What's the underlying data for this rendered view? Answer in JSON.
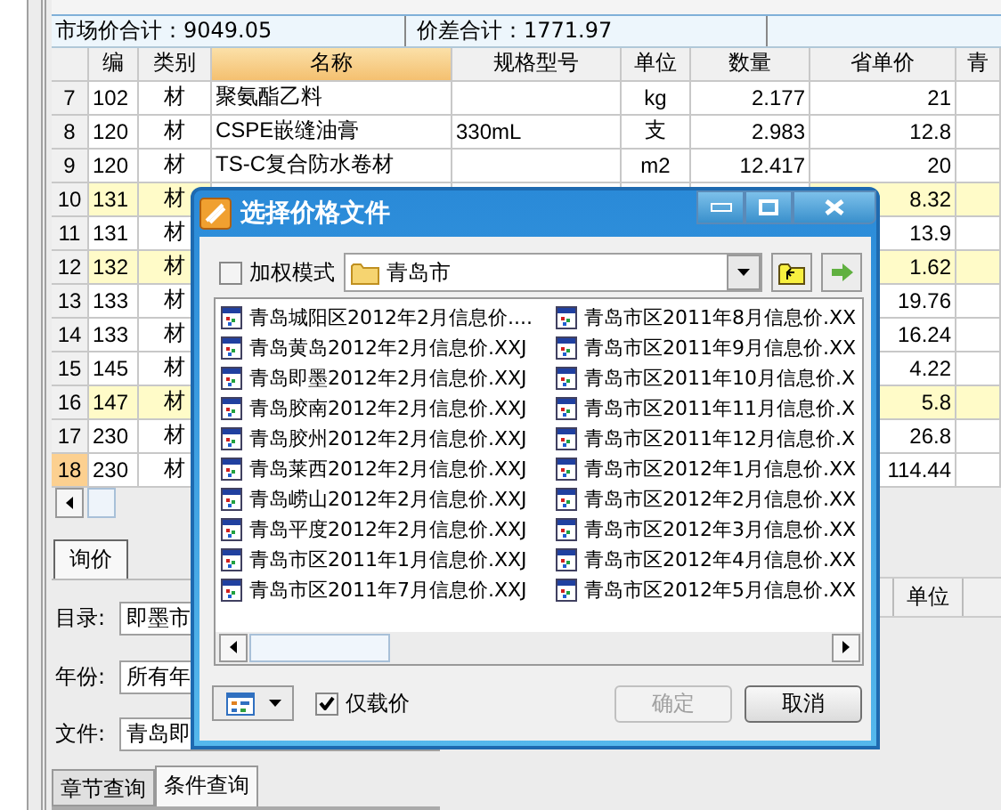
{
  "summary": {
    "market_total": "市场价合计：9049.05",
    "diff_total": "价差合计：1771.97"
  },
  "table": {
    "columns": [
      "编",
      "类别",
      "名称",
      "规格型号",
      "单位",
      "数量",
      "省单价",
      "青"
    ],
    "rows": [
      {
        "number": "7",
        "code": "102",
        "category": "材",
        "name": "聚氨酯乙料",
        "unit": "kg",
        "quantity": "2.177",
        "price": "21",
        "highlighted": false,
        "selected": false
      },
      {
        "number": "8",
        "code": "120",
        "category": "材",
        "name": "CSPE嵌缝油膏",
        "spec": "330mL",
        "unit": "支",
        "quantity": "2.983",
        "price": "12.8",
        "highlighted": false,
        "selected": false
      },
      {
        "number": "9",
        "code": "120",
        "category": "材",
        "name": "TS-C复合防水卷材",
        "unit": "m2",
        "quantity": "12.417",
        "price": "20",
        "highlighted": false,
        "selected": false
      },
      {
        "number": "10",
        "code": "131",
        "category": "材",
        "price": "8.32",
        "highlighted": true,
        "selected": false
      },
      {
        "number": "11",
        "code": "131",
        "category": "材",
        "price": "13.9",
        "highlighted": false,
        "selected": false
      },
      {
        "number": "12",
        "code": "132",
        "category": "材",
        "price": "1.62",
        "highlighted": true,
        "selected": false
      },
      {
        "number": "13",
        "code": "133",
        "category": "材",
        "price": "19.76",
        "highlighted": false,
        "selected": false
      },
      {
        "number": "14",
        "code": "133",
        "category": "材",
        "price": "16.24",
        "highlighted": false,
        "selected": false
      },
      {
        "number": "15",
        "code": "145",
        "category": "材",
        "price": "4.22",
        "highlighted": false,
        "selected": false
      },
      {
        "number": "16",
        "code": "147",
        "category": "材",
        "price": "5.8",
        "highlighted": true,
        "selected": false
      },
      {
        "number": "17",
        "code": "230",
        "category": "材",
        "price": "26.8",
        "highlighted": false,
        "selected": false
      },
      {
        "number": "18",
        "code": "230",
        "category": "材",
        "price": "114.44",
        "highlighted": false,
        "selected": true
      }
    ]
  },
  "tabs": [
    {
      "label": "询价",
      "selected": true
    }
  ],
  "form": [
    {
      "label": "目录:",
      "value": "即墨市"
    },
    {
      "label": "年份:",
      "value": "所有年"
    },
    {
      "label": "文件:",
      "value": "青岛即"
    }
  ],
  "bottom_tabs": [
    {
      "label": "章节查询",
      "selected": false
    },
    {
      "label": "条件查询",
      "selected": true
    }
  ],
  "detail_table": {
    "columns": [
      "单位"
    ]
  },
  "dialog": {
    "title": "选择价格文件",
    "weighted_mode": {
      "label": "加权模式",
      "checked": false
    },
    "folder": "青岛市",
    "files": [
      "青岛城阳区2012年2月信息价....",
      "青岛黄岛2012年2月信息价.XXJ",
      "青岛即墨2012年2月信息价.XXJ",
      "青岛胶南2012年2月信息价.XXJ",
      "青岛胶州2012年2月信息价.XXJ",
      "青岛莱西2012年2月信息价.XXJ",
      "青岛崂山2012年2月信息价.XXJ",
      "青岛平度2012年2月信息价.XXJ",
      "青岛市区2011年1月信息价.XXJ",
      "青岛市区2011年7月信息价.XXJ",
      "青岛市区2011年8月信息价.XX",
      "青岛市区2011年9月信息价.XX",
      "青岛市区2011年10月信息价.X",
      "青岛市区2011年11月信息价.X",
      "青岛市区2011年12月信息价.X",
      "青岛市区2012年1月信息价.XX",
      "青岛市区2012年2月信息价.XX",
      "青岛市区2012年3月信息价.XX",
      "青岛市区2012年4月信息价.XX",
      "青岛市区2012年5月信息价.XX"
    ],
    "price_only": {
      "label": "仅载价",
      "checked": true
    },
    "buttons": [
      {
        "label": "确定",
        "disabled": true
      },
      {
        "label": "取消",
        "disabled": false
      }
    ]
  }
}
